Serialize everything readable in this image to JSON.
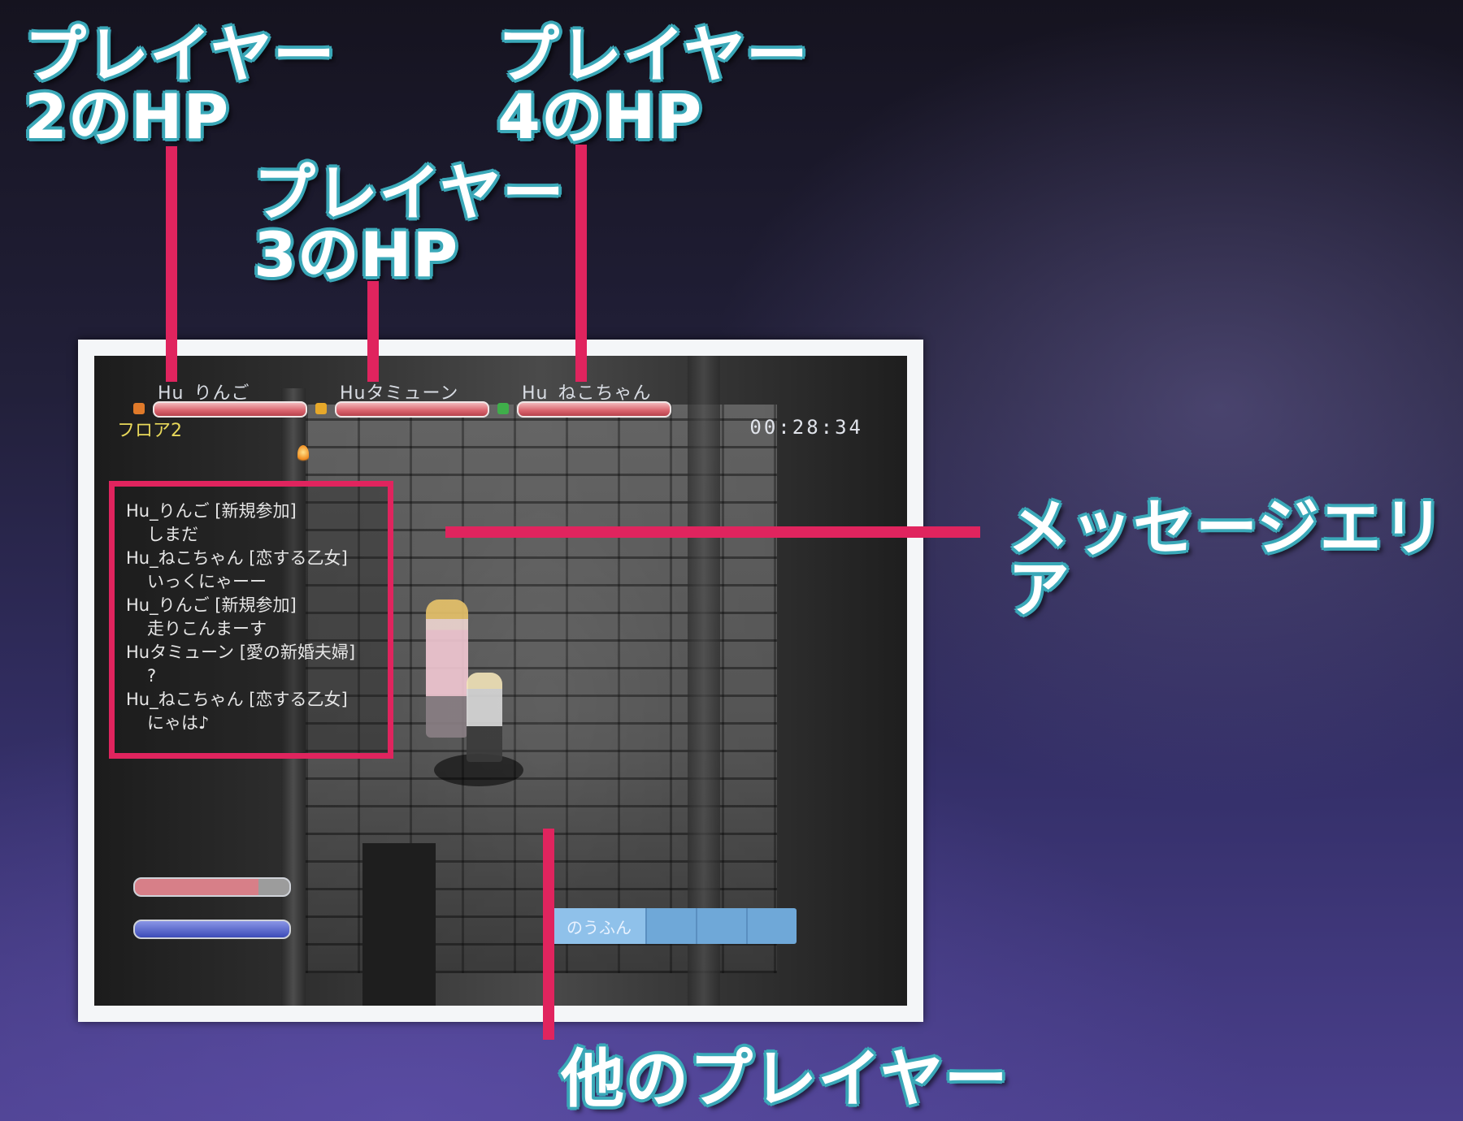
{
  "callouts": {
    "player2_hp": [
      "プレイヤー",
      "2のHP"
    ],
    "player3_hp": [
      "プレイヤー",
      "3のHP"
    ],
    "player4_hp": [
      "プレイヤー",
      "4のHP"
    ],
    "message_area": "メッセージエリア",
    "other_player": "他のプレイヤー"
  },
  "hud": {
    "party": [
      {
        "name": "Hu_りんご",
        "hp_fraction": 1.0,
        "icon_color": "#e07a2a"
      },
      {
        "name": "Huタミューン",
        "hp_fraction": 1.0,
        "icon_color": "#e6a82a"
      },
      {
        "name": "Hu_ねこちゃん",
        "hp_fraction": 1.0,
        "icon_color": "#3fae4a"
      }
    ],
    "floor": "フロア2",
    "timer": "00:28:34",
    "player_hp_fraction": 0.8,
    "player_tp_fraction": 1.0,
    "action_slot_label": "のうふん"
  },
  "messages": [
    {
      "sender": "Hu_りんご [新規参加]",
      "body": "しまだ"
    },
    {
      "sender": "Hu_ねこちゃん [恋する乙女]",
      "body": "いっくにゃーー"
    },
    {
      "sender": "Hu_りんご [新規参加]",
      "body": "走りこんまーす"
    },
    {
      "sender": "Huタミューン [愛の新婚夫婦]",
      "body": "?"
    },
    {
      "sender": "Hu_ねこちゃん [恋する乙女]",
      "body": "にゃは♪"
    }
  ],
  "colors": {
    "callout_line": "#e0245e",
    "callout_outline": "#3aa8b8",
    "hp_bar": "#d9636c",
    "floor_text": "#e8d85a"
  }
}
